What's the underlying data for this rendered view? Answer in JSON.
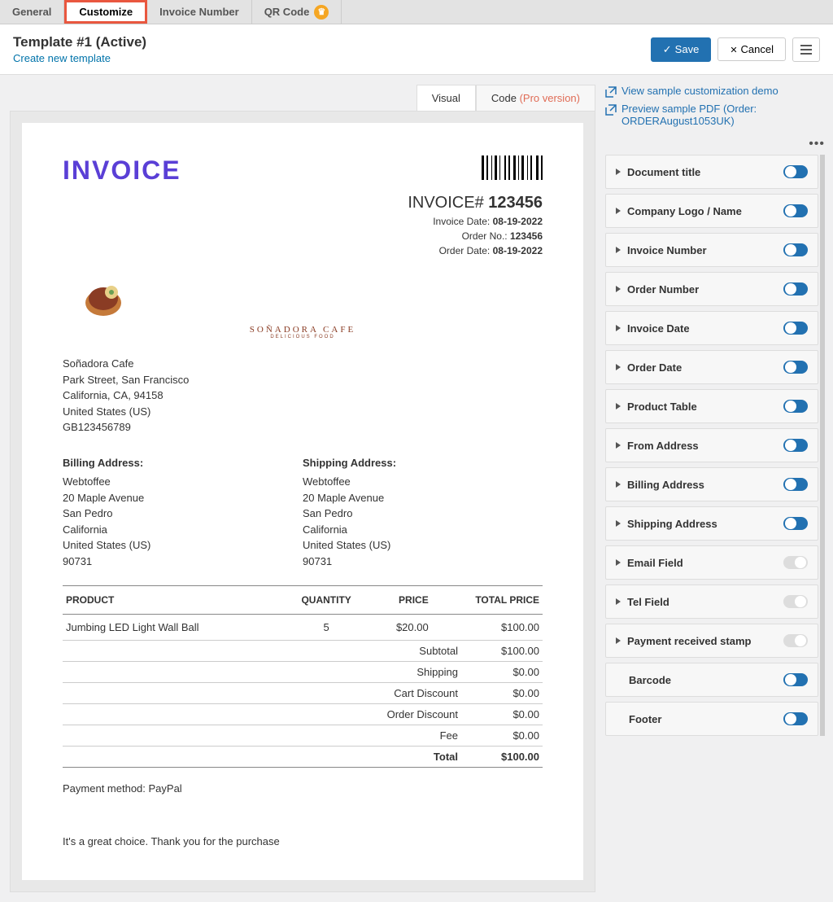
{
  "tabs": {
    "general": "General",
    "customize": "Customize",
    "invoice_number": "Invoice Number",
    "qr_code": "QR Code"
  },
  "header": {
    "title": "Template #1 (Active)",
    "create_link": "Create new template",
    "save": "Save",
    "cancel": "Cancel"
  },
  "view_tabs": {
    "visual": "Visual",
    "code": "Code",
    "pro": "(Pro version)"
  },
  "right_links": {
    "demo": "View sample customization demo",
    "preview_pdf": "Preview sample PDF (Order: ORDERAugust1053UK)"
  },
  "invoice": {
    "title": "INVOICE",
    "number_label": "INVOICE#",
    "number": "123456",
    "date_label": "Invoice Date:",
    "date": "08-19-2022",
    "order_no_label": "Order No.:",
    "order_no": "123456",
    "order_date_label": "Order Date:",
    "order_date": "08-19-2022",
    "logo_name": "SOÑADORA CAFE",
    "logo_sub": "DELICIOUS FOOD",
    "from": [
      "Soñadora Cafe",
      "Park Street, San Francisco",
      "California, CA, 94158",
      "United States (US)",
      "GB123456789"
    ],
    "billing_title": "Billing Address:",
    "billing": [
      "Webtoffee",
      "20 Maple Avenue",
      "San Pedro",
      "California",
      "United States (US)",
      "90731"
    ],
    "shipping_title": "Shipping Address:",
    "shipping": [
      "Webtoffee",
      "20 Maple Avenue",
      "San Pedro",
      "California",
      "United States (US)",
      "90731"
    ],
    "cols": {
      "product": "PRODUCT",
      "qty": "QUANTITY",
      "price": "PRICE",
      "total": "TOTAL PRICE"
    },
    "rows": [
      {
        "product": "Jumbing LED Light Wall Ball",
        "qty": "5",
        "price": "$20.00",
        "total": "$100.00"
      }
    ],
    "totals": [
      {
        "label": "Subtotal",
        "val": "$100.00"
      },
      {
        "label": "Shipping",
        "val": "$0.00"
      },
      {
        "label": "Cart Discount",
        "val": "$0.00"
      },
      {
        "label": "Order Discount",
        "val": "$0.00"
      },
      {
        "label": "Fee",
        "val": "$0.00"
      }
    ],
    "grand_label": "Total",
    "grand_val": "$100.00",
    "payment": "Payment method: PayPal",
    "footer": "It's a great choice. Thank you for the purchase"
  },
  "panels": [
    {
      "label": "Document title",
      "on": true,
      "arrow": true
    },
    {
      "label": "Company Logo / Name",
      "on": true,
      "arrow": true
    },
    {
      "label": "Invoice Number",
      "on": true,
      "arrow": true
    },
    {
      "label": "Order Number",
      "on": true,
      "arrow": true
    },
    {
      "label": "Invoice Date",
      "on": true,
      "arrow": true
    },
    {
      "label": "Order Date",
      "on": true,
      "arrow": true
    },
    {
      "label": "Product Table",
      "on": true,
      "arrow": true
    },
    {
      "label": "From Address",
      "on": true,
      "arrow": true
    },
    {
      "label": "Billing Address",
      "on": true,
      "arrow": true
    },
    {
      "label": "Shipping Address",
      "on": true,
      "arrow": true
    },
    {
      "label": "Email Field",
      "on": false,
      "arrow": true
    },
    {
      "label": "Tel Field",
      "on": false,
      "arrow": true
    },
    {
      "label": "Payment received stamp",
      "on": false,
      "arrow": true
    },
    {
      "label": "Barcode",
      "on": true,
      "arrow": false
    },
    {
      "label": "Footer",
      "on": true,
      "arrow": false
    }
  ]
}
